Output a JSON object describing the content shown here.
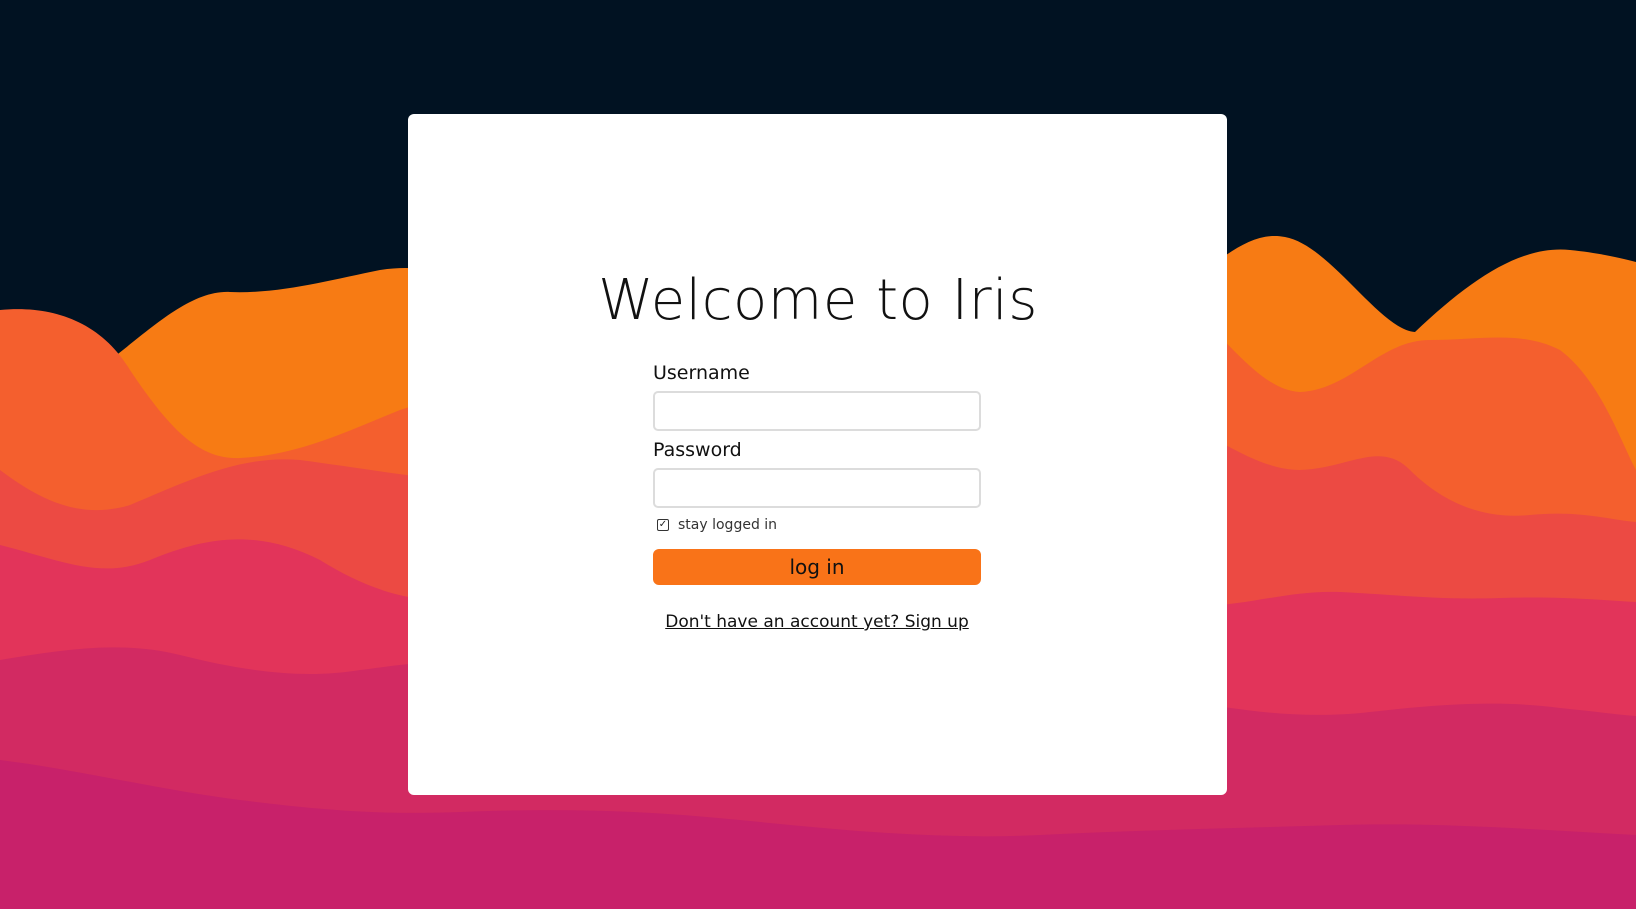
{
  "login": {
    "title": "Welcome to Iris",
    "username_label": "Username",
    "username_value": "",
    "password_label": "Password",
    "password_value": "",
    "stay_logged_in_label": "stay logged in",
    "stay_logged_in_checked": true,
    "login_button_label": "log in",
    "signup_link_text": "Don't have an account yet? Sign up"
  },
  "colors": {
    "background": "#011222",
    "accent": "#f97318",
    "wave_orange": "#f77b14",
    "wave_orange_red": "#f45f2e",
    "wave_red": "#ec4a43",
    "wave_crimson": "#e2345a",
    "wave_magenta": "#c8216a"
  },
  "icons": {
    "checkbox": "check-icon"
  }
}
